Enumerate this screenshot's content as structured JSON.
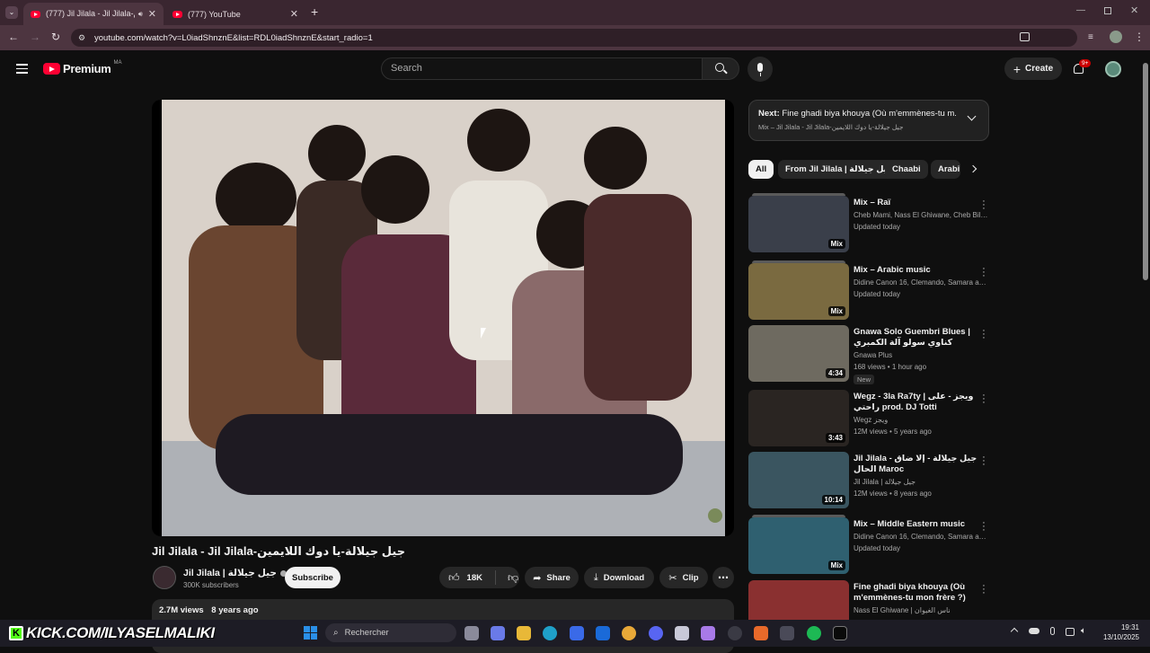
{
  "browser": {
    "tabs": [
      {
        "title": "(777) Jil Jilala - Jil Jilala-جيل جيلالة-يا دوك اللايمين",
        "active": true
      },
      {
        "title": "(777) YouTube",
        "active": false
      }
    ],
    "url": "youtube.com/watch?v=L0iadShnznE&list=RDL0iadShnznE&start_radio=1"
  },
  "header": {
    "logo": "Premium",
    "region": "MA",
    "search_placeholder": "Search",
    "create_label": "Create",
    "notif_count": "9+"
  },
  "video": {
    "title": "Jil Jilala - Jil Jilala-جيل جيلالة-يا دوك اللايمين",
    "channel": "Jil Jilala | جيل جيلالة",
    "subscribers": "300K subscribers",
    "subscribe_label": "Subscribe",
    "likes": "18K",
    "share_label": "Share",
    "download_label": "Download",
    "clip_label": "Clip",
    "views": "2.7M views",
    "age": "8 years ago"
  },
  "next": {
    "label": "Next:",
    "title": "Fine ghadi biya khouya (Où m'emmènes-tu m...",
    "sub": "Mix – Jil Jilala - Jil Jilala-جيل جيلالة-يا دوك اللايمين"
  },
  "chips": [
    "All",
    "From Jil Jilala | جيل جيلالة",
    "Chaabi",
    "Arabi"
  ],
  "recommendations": [
    {
      "title": "Mix – Raï",
      "line1": "Cheb Mami, Nass El Ghiwane, Cheb Bilal ...",
      "line2": "Updated today",
      "badge": "Mix",
      "thumb_color": "#3a3f4a"
    },
    {
      "title": "Mix – Arabic music",
      "line1": "Didine Canon 16, Clemando, Samara and...",
      "line2": "Updated today",
      "badge": "Mix",
      "thumb_color": "#7a6a40"
    },
    {
      "title": "Gnawa Solo Guembri Blues | كناوي سولو آلة الكمبري",
      "line1": "Gnawa Plus",
      "line2": "168 views • 1 hour ago",
      "badge": "4:34",
      "new_label": "New",
      "thumb_color": "#6e6a60"
    },
    {
      "title": "Wegz - 3la Ra7ty | ويجز - على راحتي prod. DJ Totti",
      "line1": "Wegz ويجز",
      "line2": "12M views • 5 years ago",
      "badge": "3:43",
      "thumb_color": "#2a2522"
    },
    {
      "title": "Jil Jilala - جيل جيلالة - إلا ضاق الحال Maroc",
      "line1": "Jil Jilala | جيل جيلالة",
      "line2": "12M views • 8 years ago",
      "badge": "10:14",
      "thumb_color": "#3a5560"
    },
    {
      "title": "Mix – Middle Eastern music",
      "line1": "Didine Canon 16, Clemando, Samara and...",
      "line2": "Updated today",
      "badge": "Mix",
      "thumb_color": "#2f6070"
    },
    {
      "title": "Fine ghadi biya khouya (Où m'emmènes-tu mon frère ?)",
      "line1": "Nass El Ghiwane | ناس الغيوان",
      "line2": "",
      "badge": "",
      "thumb_color": "#8a3030"
    }
  ],
  "taskbar": {
    "overlay_text": "KICK.COM/ILYASELMALIKI",
    "search_label": "Rechercher",
    "time": "19:31",
    "date": "13/10/2025"
  }
}
